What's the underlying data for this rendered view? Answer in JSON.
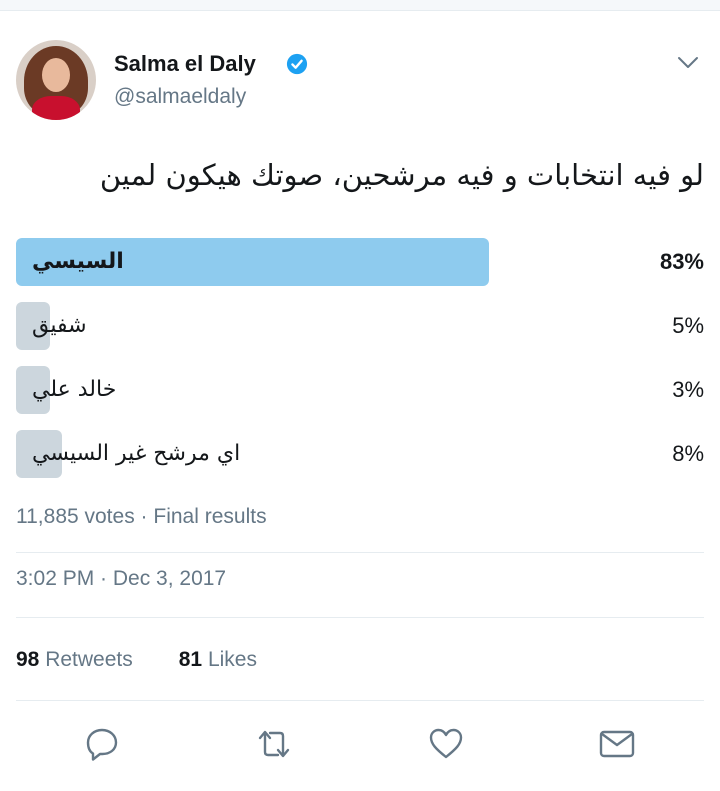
{
  "tweet": {
    "author_name": "Salma el Daly",
    "author_handle": "@salmaeldaly",
    "verified": true,
    "text": "لو فيه انتخابات و فيه مرشحين، صوتك هيكون لمين",
    "poll": {
      "options": [
        {
          "label": "السيسي",
          "percent_text": "83%",
          "percent": 83,
          "winner": true
        },
        {
          "label": "شفيق",
          "percent_text": "5%",
          "percent": 5,
          "winner": false
        },
        {
          "label": "خالد علي",
          "percent_text": "3%",
          "percent": 3,
          "winner": false
        },
        {
          "label": "اي مرشح غير السيسي",
          "percent_text": "8%",
          "percent": 8,
          "winner": false
        }
      ],
      "votes_summary": "11,885 votes · Final results"
    },
    "timestamp": "3:02 PM · Dec 3, 2017",
    "retweets_count": "98",
    "retweets_label": "Retweets",
    "likes_count": "81",
    "likes_label": "Likes"
  },
  "colors": {
    "winner_bar": "#8ecbee",
    "other_bar": "#ccd6dd",
    "verified_blue": "#1da1f2",
    "muted_text": "#657786"
  },
  "icons": {
    "menu": "chevron-down-icon",
    "verified": "verified-badge-icon",
    "reply": "reply-icon",
    "retweet": "retweet-icon",
    "like": "heart-icon",
    "message": "envelope-icon"
  }
}
